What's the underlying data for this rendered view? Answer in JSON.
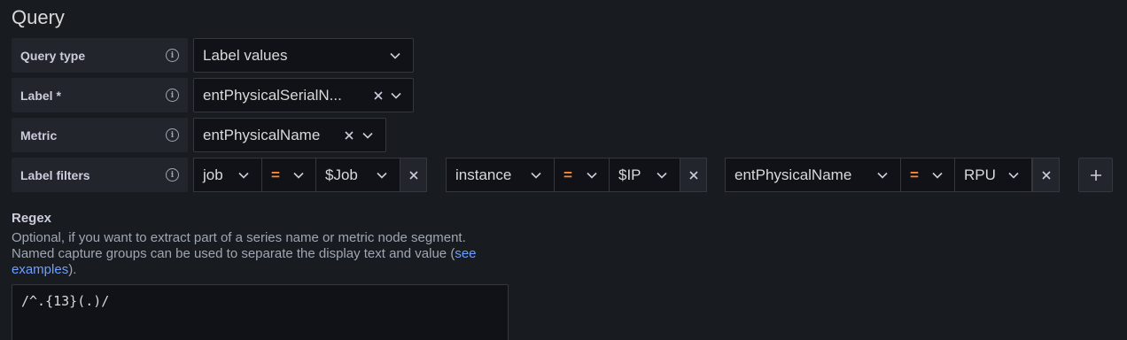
{
  "title": "Query",
  "query_type": {
    "label": "Query type",
    "value": "Label values"
  },
  "label": {
    "label": "Label *",
    "value": "entPhysicalSerialN..."
  },
  "metric": {
    "label": "Metric",
    "value": "entPhysicalName"
  },
  "label_filters": {
    "label": "Label filters",
    "filters": [
      {
        "key": "job",
        "op": "=",
        "value": "$Job"
      },
      {
        "key": "instance",
        "op": "=",
        "value": "$IP"
      },
      {
        "key": "entPhysicalName",
        "op": "=",
        "value": "RPU"
      }
    ]
  },
  "regex": {
    "title": "Regex",
    "description_line1": "Optional, if you want to extract part of a series name or metric node segment.",
    "description_line2": "Named capture groups can be used to separate the display text and value (",
    "link_text_1": "see",
    "link_text_2": "examples",
    "description_end": ").",
    "value": "/^.{13}(.)/"
  },
  "colors": {
    "background": "#181b1f",
    "label_bg": "#22252b",
    "input_bg": "#111217",
    "operator": "#ff8833",
    "link": "#6e9fff"
  },
  "icons": [
    "info-circle-icon",
    "chevron-down-icon",
    "close-icon",
    "plus-icon"
  ]
}
